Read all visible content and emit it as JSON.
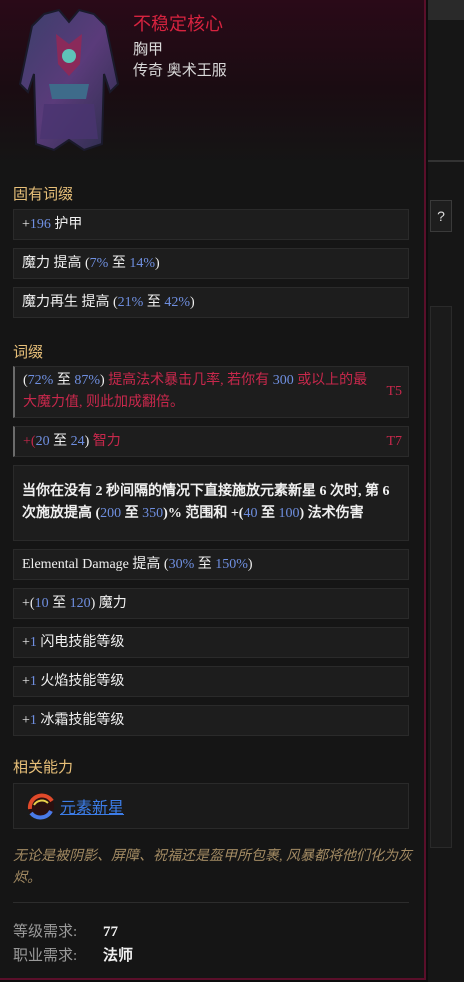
{
  "item": {
    "name": "不稳定核心",
    "type": "胸甲",
    "rarity": "传奇 奥术王服"
  },
  "implicit": {
    "title": "固有词缀",
    "rows": [
      {
        "prefix": "+",
        "value": "196",
        "text": " 护甲"
      },
      {
        "prefix": "魔力 提高 (",
        "value": "7%",
        "mid": " 至 ",
        "value2": "14%",
        "suffix": ")"
      },
      {
        "prefix": "魔力再生 提高 (",
        "value": "21%",
        "mid": " 至 ",
        "value2": "42%",
        "suffix": ")"
      }
    ]
  },
  "affixes": {
    "title": "词缀",
    "rows": [
      {
        "id": "crit",
        "a": "(",
        "v1": "72%",
        "b": " 至 ",
        "v2": "87%",
        "c": ")",
        "red1": " 提高法术暴击几率, 若你有 ",
        "v3": "300",
        "red2": " 或以上的最大魔力值, 则此加成翻倍。",
        "tier": "T5"
      },
      {
        "id": "int",
        "a": "+(",
        "v1": "20",
        "b": " 至 ",
        "v2": "24",
        "c": ")",
        "red1": " 智力",
        "tier": "T7"
      },
      {
        "id": "nova",
        "t1": "当你在没有 2 秒间隔的情况下直接施放元素新星 6 次时, 第 6 次施放提高 (",
        "v1": "200",
        "b": " 至 ",
        "v2": "350",
        "t2": ")% 范围和 +(",
        "v3": "40",
        "b2": " 至 ",
        "v4": "100",
        "t3": ") 法术伤害"
      },
      {
        "id": "ele",
        "t1": "Elemental Damage 提高 (",
        "v1": "30%",
        "b": " 至 ",
        "v2": "150%",
        "t2": ")"
      },
      {
        "id": "mana",
        "t1": "+(",
        "v1": "10",
        "b": " 至 ",
        "v2": "120",
        "t2": ") 魔力"
      },
      {
        "id": "lightning",
        "t1": "+",
        "v1": "1",
        "t2": " 闪电技能等级"
      },
      {
        "id": "fire",
        "t1": "+",
        "v1": "1",
        "t2": " 火焰技能等级"
      },
      {
        "id": "frost",
        "t1": "+",
        "v1": "1",
        "t2": " 冰霜技能等级"
      }
    ]
  },
  "related": {
    "title": "相关能力",
    "skill": "元素新星",
    "icon": "elemental-nova-icon"
  },
  "flavor": "无论是被阴影、屏障、祝福还是盔甲所包裹, 风暴都将他们化为灰烬。",
  "requirements": {
    "level_label": "等级需求:",
    "level_value": "77",
    "class_label": "职业需求:",
    "class_value": "法师"
  },
  "background": {
    "help": "?"
  },
  "colors": {
    "accent": "#d6233f",
    "section": "#e8c079",
    "range": "#6f8fe0",
    "link": "#3c7de8",
    "flavor": "#a38b63"
  }
}
